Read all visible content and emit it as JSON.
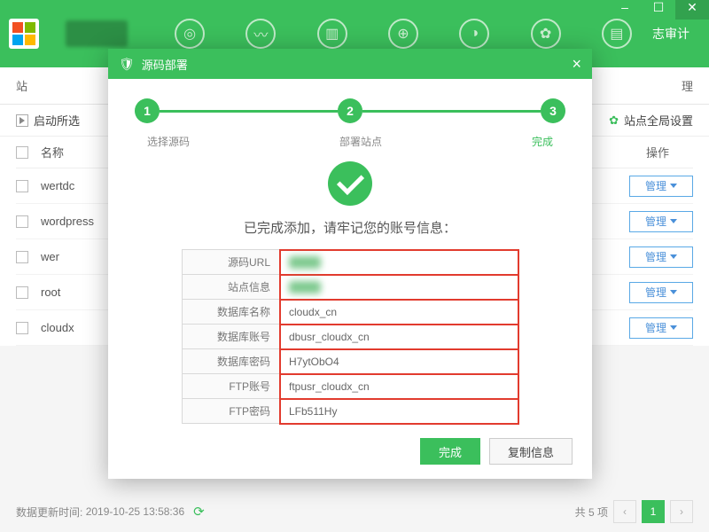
{
  "header": {
    "audit_label": "志审计"
  },
  "subbar": {
    "left": "站",
    "right": "理"
  },
  "toolbar": {
    "start_selected": "启动所选",
    "global_settings": "站点全局设置"
  },
  "list": {
    "name_col": "名称",
    "op_col": "操作",
    "op_button": "管理",
    "rows": [
      "wertdc",
      "wordpress",
      "wer",
      "root",
      "cloudx"
    ]
  },
  "footer": {
    "update_label": "数据更新时间:",
    "update_time": "2019-10-25 13:58:36",
    "total_label": "共 5 项",
    "page": "1"
  },
  "modal": {
    "title": "源码部署",
    "steps": {
      "s1": "1",
      "s2": "2",
      "s3": "3",
      "l1": "选择源码",
      "l2": "部署站点",
      "l3": "完成"
    },
    "done_msg": "已完成添加，请牢记您的账号信息：",
    "fields": {
      "source_url": {
        "label": "源码URL",
        "value": "hidden"
      },
      "site_info": {
        "label": "站点信息",
        "value": "hidden"
      },
      "db_name": {
        "label": "数据库名称",
        "value": "cloudx_cn"
      },
      "db_user": {
        "label": "数据库账号",
        "value": "dbusr_cloudx_cn"
      },
      "db_pass": {
        "label": "数据库密码",
        "value": "H7ytObO4"
      },
      "ftp_user": {
        "label": "FTP账号",
        "value": "ftpusr_cloudx_cn"
      },
      "ftp_pass": {
        "label": "FTP密码",
        "value": "LFb511Hy"
      }
    },
    "buttons": {
      "done": "完成",
      "copy": "复制信息"
    }
  }
}
